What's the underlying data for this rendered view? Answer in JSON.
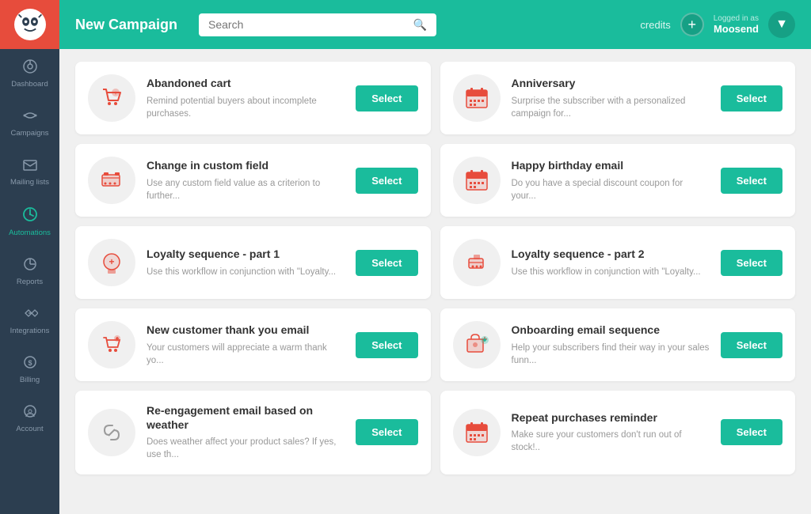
{
  "sidebar": {
    "logo_emoji": "🐾",
    "items": [
      {
        "id": "dashboard",
        "label": "Dashboard",
        "icon": "⊙",
        "active": false
      },
      {
        "id": "campaigns",
        "label": "Campaigns",
        "icon": "📢",
        "active": false
      },
      {
        "id": "mailing-lists",
        "label": "Mailing lists",
        "icon": "✉",
        "active": false
      },
      {
        "id": "automations",
        "label": "Automations",
        "icon": "⏱",
        "active": true
      },
      {
        "id": "reports",
        "label": "Reports",
        "icon": "⊕",
        "active": false
      },
      {
        "id": "integrations",
        "label": "Integrations",
        "icon": "✦",
        "active": false
      },
      {
        "id": "billing",
        "label": "Billing",
        "icon": "$",
        "active": false
      },
      {
        "id": "account",
        "label": "Account",
        "icon": "⚙",
        "active": false
      }
    ]
  },
  "topbar": {
    "title": "New Campaign",
    "search_placeholder": "Search",
    "credits_label": "credits",
    "add_icon": "+",
    "logged_in_label": "Logged in as",
    "user_name": "Moosend",
    "chevron": "▼"
  },
  "campaigns": [
    {
      "id": "abandoned-cart",
      "title": "Abandoned cart",
      "desc": "Remind potential buyers about incomplete purchases.",
      "icon_type": "cart",
      "select_label": "Select"
    },
    {
      "id": "anniversary",
      "title": "Anniversary",
      "desc": "Surprise the subscriber with a personalized campaign for...",
      "icon_type": "calendar",
      "select_label": "Select"
    },
    {
      "id": "change-custom-field",
      "title": "Change in custom field",
      "desc": "Use any custom field value as a criterion to further...",
      "icon_type": "tag",
      "select_label": "Select"
    },
    {
      "id": "happy-birthday",
      "title": "Happy birthday email",
      "desc": "Do you have a special discount coupon for your...",
      "icon_type": "calendar",
      "select_label": "Select"
    },
    {
      "id": "loyalty-part1",
      "title": "Loyalty sequence - part 1",
      "desc": "Use this workflow in conjunction with \"Loyalty...",
      "icon_type": "badge",
      "select_label": "Select"
    },
    {
      "id": "loyalty-part2",
      "title": "Loyalty sequence - part 2",
      "desc": "Use this workflow in conjunction with \"Loyalty...",
      "icon_type": "tag2",
      "select_label": "Select"
    },
    {
      "id": "new-customer",
      "title": "New customer thank you email",
      "desc": "Your customers will appreciate a warm thank yo...",
      "icon_type": "cart2",
      "select_label": "Select"
    },
    {
      "id": "onboarding",
      "title": "Onboarding email sequence",
      "desc": "Help your subscribers find their way in your sales funn...",
      "icon_type": "cart3",
      "select_label": "Select"
    },
    {
      "id": "reengagement",
      "title": "Re-engagement email based on weather",
      "desc": "Does weather affect your product sales? If yes, use th...",
      "icon_type": "link",
      "select_label": "Select"
    },
    {
      "id": "repeat-purchases",
      "title": "Repeat purchases reminder",
      "desc": "Make sure your customers don't run out of stock!..",
      "icon_type": "calendar",
      "select_label": "Select"
    }
  ]
}
